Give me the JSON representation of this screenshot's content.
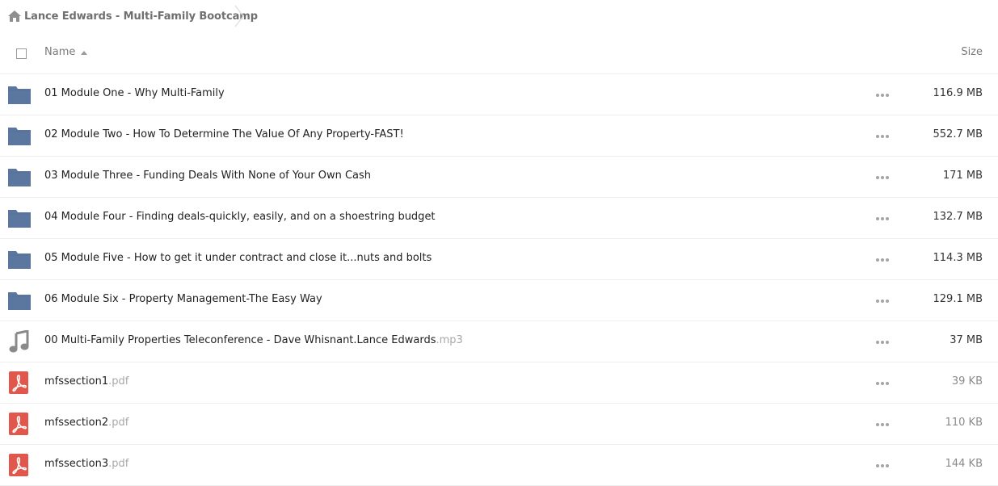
{
  "breadcrumb": {
    "home_label": "Lance Edwards - Multi-Family Bootcamp",
    "home_icon": "home-icon"
  },
  "header": {
    "name_label": "Name",
    "size_label": "Size",
    "sort": "ascending"
  },
  "colors": {
    "folder": "#5b77a0",
    "pdf": "#e2574c",
    "audio": "#8a8a8a"
  },
  "files": [
    {
      "type": "folder",
      "icon": "folder-icon",
      "name": "01 Module One - Why Multi-Family",
      "ext": "",
      "size": "116.9 MB"
    },
    {
      "type": "folder",
      "icon": "folder-icon",
      "name": "02 Module Two - How To Determine The Value Of Any Property-FAST!",
      "ext": "",
      "size": "552.7 MB"
    },
    {
      "type": "folder",
      "icon": "folder-icon",
      "name": "03 Module Three - Funding Deals With None of Your Own Cash",
      "ext": "",
      "size": "171 MB"
    },
    {
      "type": "folder",
      "icon": "folder-icon",
      "name": "04 Module Four - Finding deals-quickly, easily, and on a shoestring budget",
      "ext": "",
      "size": "132.7 MB"
    },
    {
      "type": "folder",
      "icon": "folder-icon",
      "name": "05 Module Five - How to get it under contract and close it...nuts and bolts",
      "ext": "",
      "size": "114.3 MB"
    },
    {
      "type": "folder",
      "icon": "folder-icon",
      "name": "06 Module Six - Property Management-The Easy Way",
      "ext": "",
      "size": "129.1 MB"
    },
    {
      "type": "audio",
      "icon": "music-note-icon",
      "name": "00 Multi-Family Properties Teleconference - Dave Whisnant.Lance Edwards",
      "ext": ".mp3",
      "size": "37 MB"
    },
    {
      "type": "pdf",
      "icon": "pdf-icon",
      "name": "mfssection1",
      "ext": ".pdf",
      "size": "39 KB"
    },
    {
      "type": "pdf",
      "icon": "pdf-icon",
      "name": "mfssection2",
      "ext": ".pdf",
      "size": "110 KB"
    },
    {
      "type": "pdf",
      "icon": "pdf-icon",
      "name": "mfssection3",
      "ext": ".pdf",
      "size": "144 KB"
    }
  ]
}
